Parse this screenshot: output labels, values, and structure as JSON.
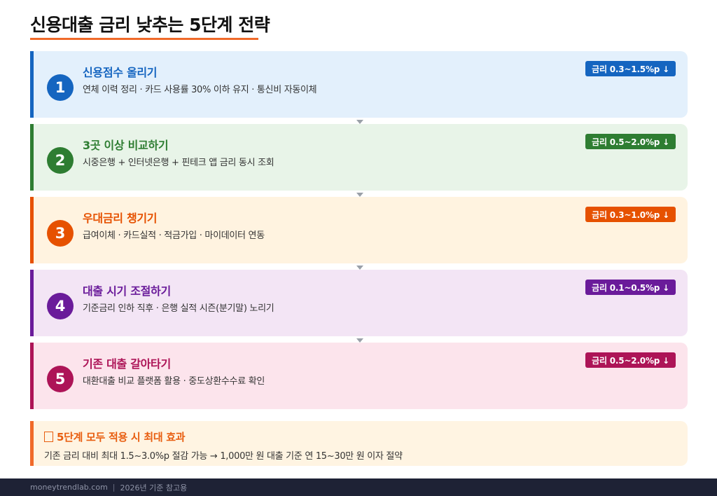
{
  "title": "신용대출 금리 낮추는 5단계 전략",
  "steps": [
    {
      "number": "1",
      "heading": "신용점수 올리기",
      "desc": "연체 이력 정리 · 카드 사용률 30% 이하 유지 · 통신비 자동이체",
      "badge": "금리 0.3~1.5%p ↓",
      "accent": "#1565c0",
      "bg": "#e3f0fc"
    },
    {
      "number": "2",
      "heading": "3곳 이상 비교하기",
      "desc": "시중은행 + 인터넷은행 + 핀테크 앱 금리 동시 조회",
      "badge": "금리 0.5~2.0%p ↓",
      "accent": "#2e7d32",
      "bg": "#e8f4e8"
    },
    {
      "number": "3",
      "heading": "우대금리 챙기기",
      "desc": "급여이체 · 카드실적 · 적금가입 · 마이데이터 연동",
      "badge": "금리 0.3~1.0%p ↓",
      "accent": "#e65100",
      "bg": "#fff3e0"
    },
    {
      "number": "4",
      "heading": "대출 시기 조절하기",
      "desc": "기준금리 인하 직후 · 은행 실적 시즌(분기말) 노리기",
      "badge": "금리 0.1~0.5%p ↓",
      "accent": "#6a1b9a",
      "bg": "#f3e5f5"
    },
    {
      "number": "5",
      "heading": "기존 대출 갈아타기",
      "desc": "대환대출 비교 플랫폼 활용 · 중도상환수수료 확인",
      "badge": "금리 0.5~2.0%p ↓",
      "accent": "#ad1457",
      "bg": "#fce4ec"
    }
  ],
  "summary": {
    "title": "5단계 모두 적용 시 최대 효과",
    "desc": "기존 금리 대비 최대 1.5~3.0%p 절감 가능  →  1,000만 원 대출 기준 연 15~30만 원 이자 절약"
  },
  "footer": {
    "site": "moneytrendlab.com",
    "separator": "|",
    "note": "2026년 기준 참고용"
  }
}
